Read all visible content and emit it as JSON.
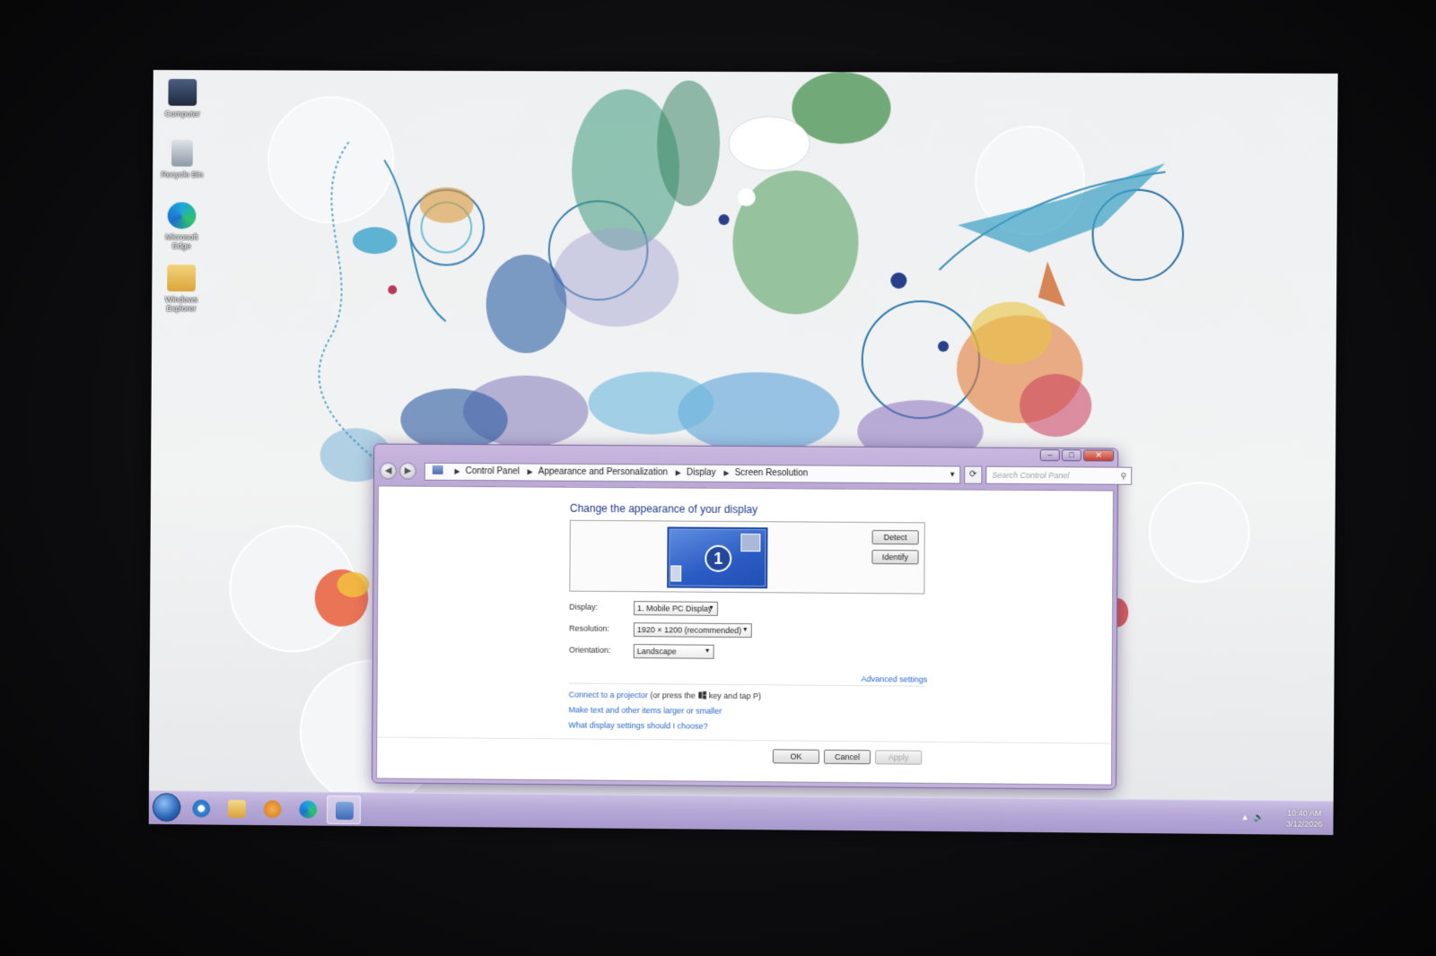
{
  "desktop": {
    "icons": [
      {
        "label": "Computer"
      },
      {
        "label": "Recycle Bin"
      },
      {
        "label": "Microsoft Edge"
      },
      {
        "label": "Windows Explorer"
      }
    ]
  },
  "window": {
    "title_buttons": {
      "minimize": "–",
      "maximize": "□",
      "close": "✕"
    },
    "nav": {
      "back": "◀",
      "forward": "▶"
    },
    "breadcrumb": [
      "Control Panel",
      "Appearance and Personalization",
      "Display",
      "Screen Resolution"
    ],
    "refresh_symbol": "⟳",
    "search_placeholder": "Search Control Panel",
    "heading": "Change the appearance of your display",
    "monitor_number": "1",
    "detect_button": "Detect",
    "identify_button": "Identify",
    "fields": {
      "display_label": "Display:",
      "display_value": "1. Mobile PC Display",
      "resolution_label": "Resolution:",
      "resolution_value": "1920 × 1200 (recommended)",
      "orientation_label": "Orientation:",
      "orientation_value": "Landscape"
    },
    "advanced_settings": "Advanced settings",
    "links": {
      "projector": "Connect to a projector",
      "projector_suffix_a": "(or press the",
      "projector_suffix_b": "key and tap P)",
      "text_size": "Make text and other items larger or smaller",
      "which_settings": "What display settings should I choose?"
    },
    "buttons": {
      "ok": "OK",
      "cancel": "Cancel",
      "apply": "Apply"
    }
  },
  "taskbar": {
    "items": [
      "start",
      "internet-explorer",
      "file-explorer",
      "media-player",
      "edge",
      "control-panel"
    ],
    "clock_time": "10:40 AM",
    "clock_date": "3/12/2026"
  },
  "colors": {
    "link": "#2c67c9",
    "heading": "#1e3a8a",
    "window_frame": "#c2b1dc",
    "taskbar": "#b5a8d6",
    "monitor_blue": "#2a5bc4"
  }
}
